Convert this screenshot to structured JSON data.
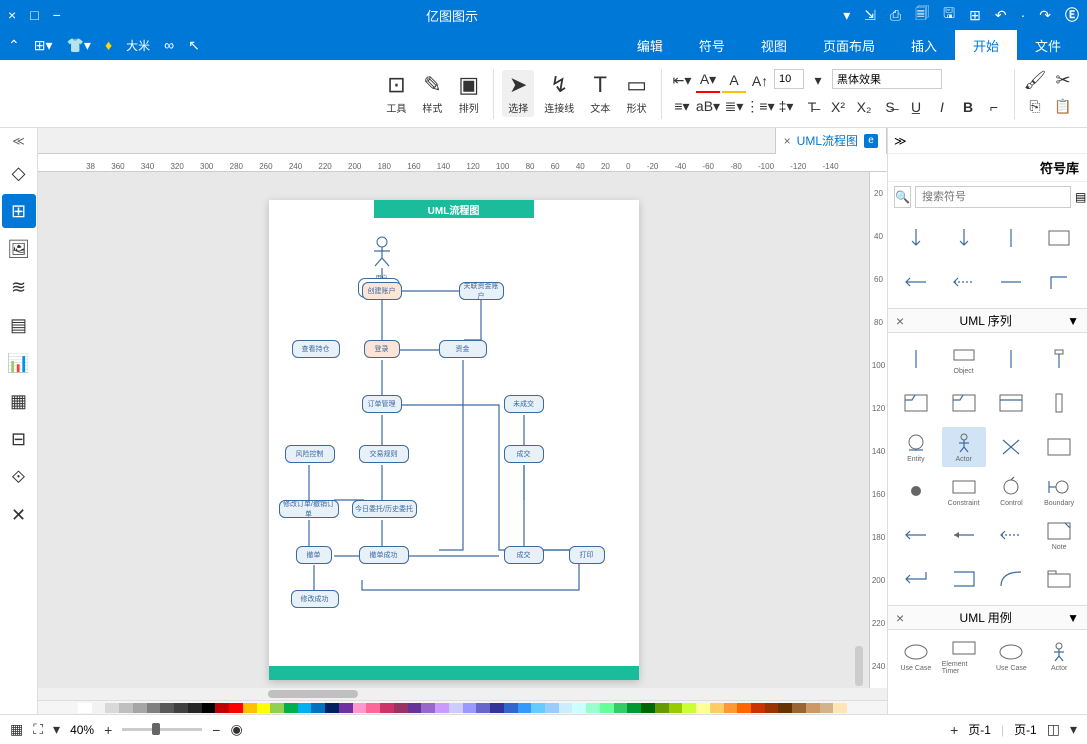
{
  "title_bar": {
    "app_title": "亿图图示"
  },
  "menu": {
    "tabs": [
      "文件",
      "开始",
      "插入",
      "页面布局",
      "视图",
      "符号",
      "编辑"
    ],
    "active": 1,
    "user_label": "大米"
  },
  "ribbon": {
    "font_family": "黑体效果",
    "font_size": "10",
    "groups": {
      "tools": "工具",
      "style": "样式",
      "arrange": "排列",
      "select": "选择",
      "connector": "连接线",
      "text": "文本",
      "shape": "形状"
    }
  },
  "doc_tabs": [
    {
      "label": "UML流程图"
    }
  ],
  "ruler_h": [
    "-140",
    "-120",
    "-100",
    "-80",
    "-60",
    "-40",
    "-20",
    "0",
    "20",
    "40",
    "60",
    "80",
    "100",
    "120",
    "140",
    "160",
    "180",
    "200",
    "220",
    "240",
    "260",
    "280",
    "300",
    "320",
    "340",
    "360",
    "38"
  ],
  "ruler_v": [
    "20",
    "40",
    "60",
    "80",
    "100",
    "120",
    "140",
    "160",
    "180",
    "200",
    "220",
    "240"
  ],
  "page": {
    "title": "UML流程图"
  },
  "shapes": {
    "actor_label": "用户",
    "s1": "创建账户",
    "s2": "关联资金账户",
    "s3": "登录",
    "s4": "资金",
    "s5": "查看持仓",
    "s6": "订单管理",
    "s7": "未成交",
    "s8": "交易规则",
    "s9": "风险控制",
    "s10": "成交",
    "s11": "今日委托/历史委托",
    "s12": "修改订单/撤销订单",
    "s13": "撤单",
    "s14": "撤单成功",
    "s15": "成交",
    "s16": "打印",
    "s17": "修改成功"
  },
  "right_panel": {
    "title": "符号库",
    "search_placeholder": "搜索符号",
    "sections": {
      "uml_seq": "UML 序列",
      "uml_use": "UML 用例"
    },
    "shape_labels": {
      "actor": "Actor",
      "entity": "Entity",
      "boundary": "Boundary",
      "control": "Control",
      "object": "Object",
      "constraint": "Constraint",
      "el_time": "Element Timer",
      "usecase": "Use Case",
      "note": "Note"
    }
  },
  "status_bar": {
    "page_indicator_left": "页-1",
    "zoom_value": "40%",
    "page_indicator_right": "页-1"
  },
  "colors": [
    "#ffffff",
    "#f2f2f2",
    "#d9d9d9",
    "#bfbfbf",
    "#a6a6a6",
    "#808080",
    "#595959",
    "#404040",
    "#262626",
    "#000000",
    "#c00000",
    "#ff0000",
    "#ffc000",
    "#ffff00",
    "#92d050",
    "#00b050",
    "#00b0f0",
    "#0070c0",
    "#002060",
    "#7030a0",
    "#ff99cc",
    "#ff6699",
    "#cc3366",
    "#993366",
    "#663399",
    "#9966cc",
    "#cc99ff",
    "#ccccff",
    "#9999ff",
    "#6666cc",
    "#333399",
    "#3366cc",
    "#3399ff",
    "#66ccff",
    "#99ccff",
    "#ccecff",
    "#ccffff",
    "#99ffcc",
    "#66ff99",
    "#33cc66",
    "#009933",
    "#006600",
    "#669900",
    "#99cc00",
    "#ccff33",
    "#ffff99",
    "#ffcc66",
    "#ff9933",
    "#ff6600",
    "#cc3300",
    "#993300",
    "#663300",
    "#996633",
    "#cc9966",
    "#d2b48c",
    "#ffe4b5"
  ]
}
